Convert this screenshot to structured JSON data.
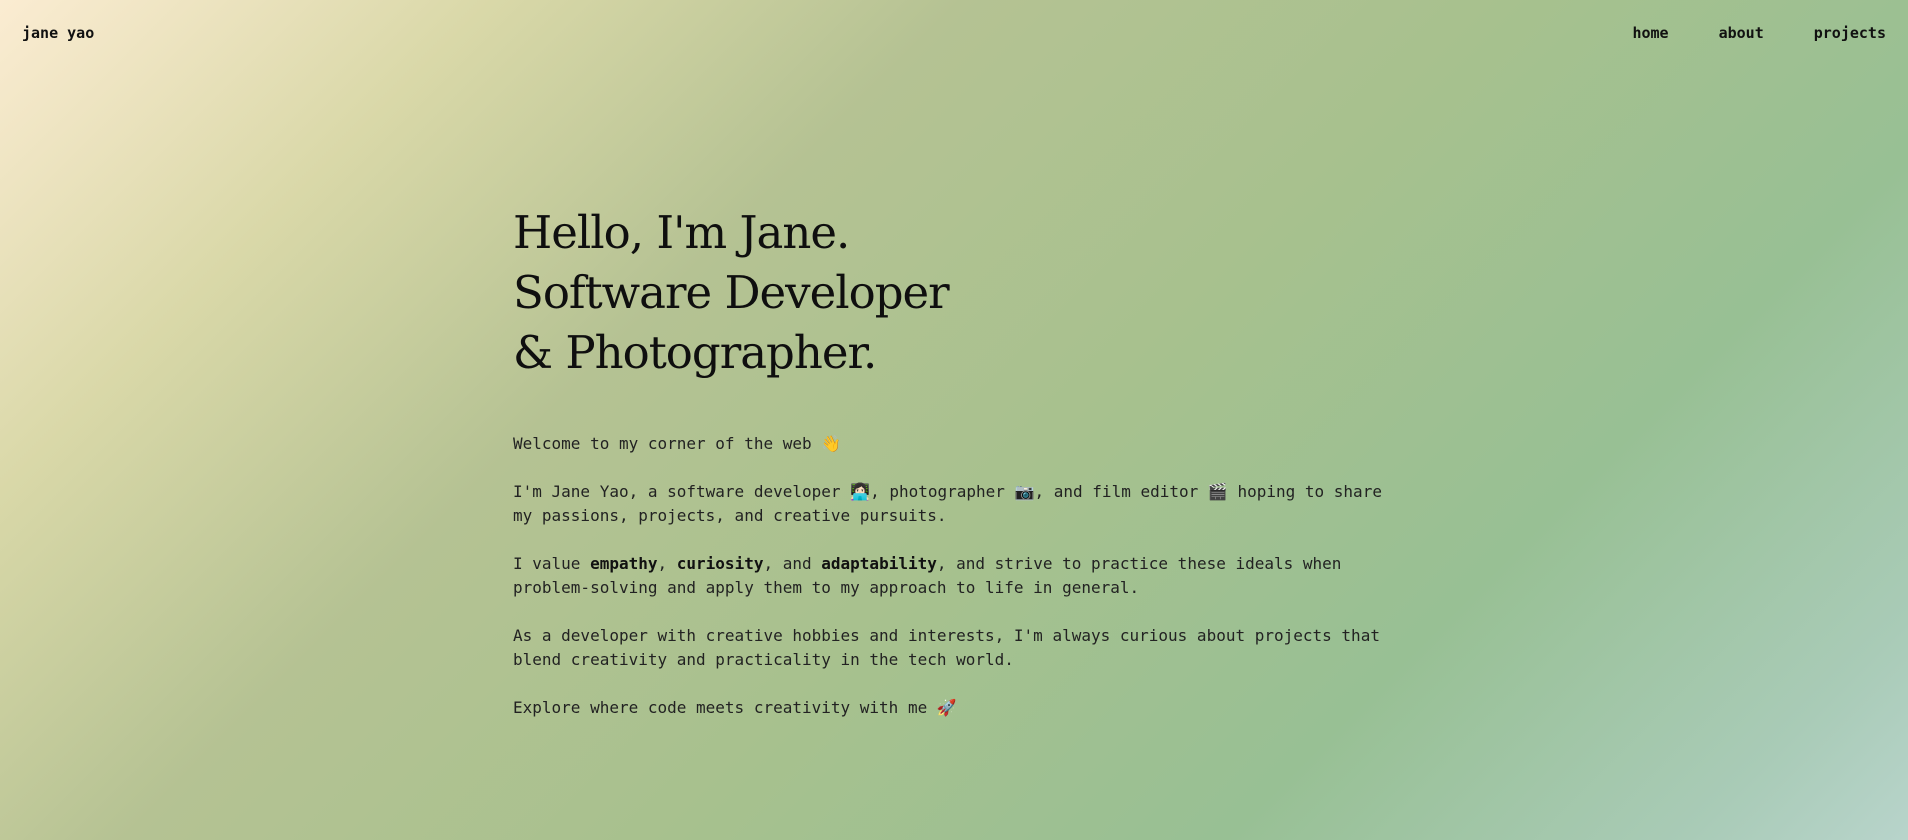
{
  "header": {
    "logo": "jane yao",
    "nav": {
      "home": "home",
      "about": "about",
      "projects": "projects"
    }
  },
  "hero": {
    "line1": "Hello, I'm Jane.",
    "line2": "Software Developer",
    "line3": "& Photographer."
  },
  "intro": {
    "welcome_text": "Welcome to my corner of the web",
    "welcome_emoji": "👋",
    "p2_a": "I'm Jane Yao, a software developer",
    "p2_emoji1": "👩🏻‍💻",
    "p2_b": ", photographer",
    "p2_emoji2": "📷",
    "p2_c": ", and film editor",
    "p2_emoji3": "🎬",
    "p2_d": " hoping to share my passions, projects, and creative pursuits.",
    "p3_a": "I value ",
    "p3_b1": "empathy",
    "p3_sep1": ", ",
    "p3_b2": "curiosity",
    "p3_sep2": ", and ",
    "p3_b3": "adaptability",
    "p3_c": ", and strive to practice these ideals when problem-solving and apply them to my approach to life in general.",
    "p4": "As a developer with creative hobbies and interests, I'm always curious about projects that blend creativity and practicality in the tech world.",
    "p5_text": "Explore where code meets creativity with me",
    "p5_emoji": "🚀"
  },
  "colors": {
    "gradient_start": "#fbecd2",
    "gradient_mid": "#a7c18e",
    "gradient_end": "#b8d4cb",
    "text": "#1a1a1a"
  }
}
